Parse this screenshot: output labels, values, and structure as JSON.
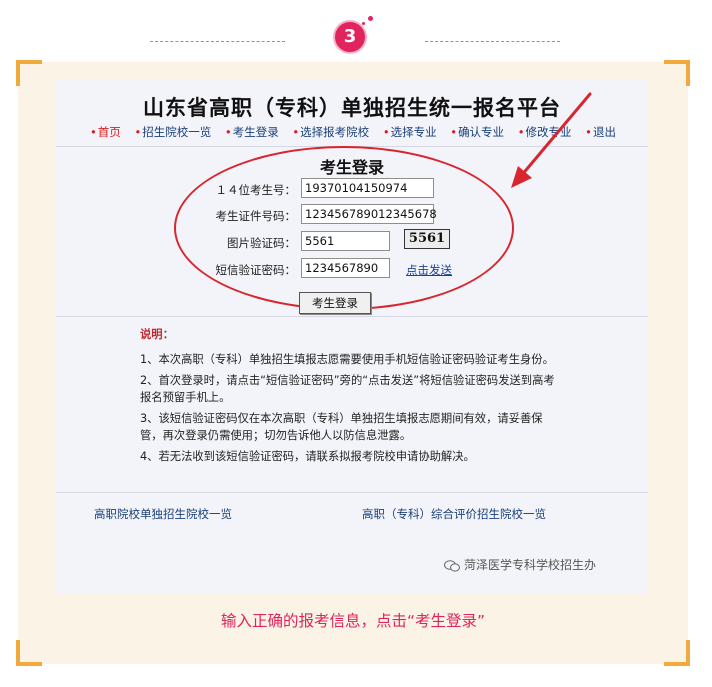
{
  "step": {
    "number": "3"
  },
  "screenshot": {
    "title": "山东省高职（专科）单独招生统一报名平台",
    "nav": [
      {
        "label": "首页",
        "active": true
      },
      {
        "label": "招生院校一览",
        "active": false
      },
      {
        "label": "考生登录",
        "active": false
      },
      {
        "label": "选择报考院校",
        "active": false
      },
      {
        "label": "选择专业",
        "active": false
      },
      {
        "label": "确认专业",
        "active": false
      },
      {
        "label": "修改专业",
        "active": false
      },
      {
        "label": "退出",
        "active": false
      }
    ],
    "login": {
      "title": "考生登录",
      "exam_id_label": "１４位考生号：",
      "exam_id_value": "19370104150974",
      "id_card_label": "考生证件号码：",
      "id_card_value": "123456789012345678",
      "captcha_label": "图片验证码：",
      "captcha_value": "5561",
      "captcha_image_text": "5561",
      "sms_label": "短信验证密码：",
      "sms_value": "1234567890",
      "send_link": "点击发送",
      "submit_label": "考生登录"
    },
    "notes": {
      "heading": "说明：",
      "items": [
        "1、本次高职（专科）单独招生填报志愿需要使用手机短信验证密码验证考生身份。",
        "2、首次登录时，请点击“短信验证密码”旁的“点击发送”将短信验证密码发送到高考报名预留手机上。",
        "3、该短信验证密码仅在本次高职（专科）单独招生填报志愿期间有效，请妥善保管，再次登录仍需使用；切勿告诉他人以防信息泄露。",
        "4、若无法收到该短信验证密码，请联系拟报考院校申请协助解决。"
      ]
    },
    "bottom_links": {
      "left": "高职院校单独招生院校一览",
      "right": "高职（专科）综合评价招生院校一览"
    },
    "watermark": "菏泽医学专科学校招生办"
  },
  "caption": "输入正确的报考信息，点击“考生登录”",
  "colors": {
    "accent": "#e0245e",
    "frame_corner": "#f0a93b",
    "annotation_red": "#d8262f"
  }
}
